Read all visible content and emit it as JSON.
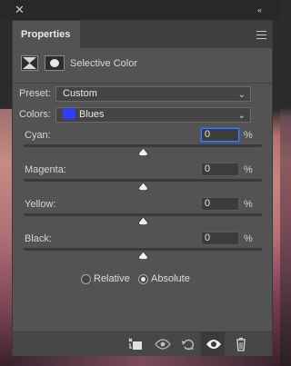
{
  "topbar": {
    "close_icon": "close-icon",
    "collapse_glyph": "‹‹"
  },
  "panel": {
    "tab_label": "Properties",
    "adjustment_title": "Selective Color",
    "preset": {
      "label": "Preset:",
      "value": "Custom"
    },
    "colors": {
      "label": "Colors:",
      "value": "Blues",
      "swatch_color": "#2f3dff"
    },
    "sliders": [
      {
        "label": "Cyan:",
        "value": "0",
        "unit": "%",
        "level": 0
      },
      {
        "label": "Magenta:",
        "value": "0",
        "unit": "%",
        "level": 0
      },
      {
        "label": "Yellow:",
        "value": "0",
        "unit": "%",
        "level": 0
      },
      {
        "label": "Black:",
        "value": "0",
        "unit": "%",
        "level": 0
      }
    ],
    "method": {
      "relative_label": "Relative",
      "absolute_label": "Absolute",
      "selected": "Absolute"
    },
    "bottom_icons": [
      "clip-to-layer-icon",
      "view-previous-state-icon",
      "reset-icon",
      "visibility-icon",
      "trash-icon"
    ],
    "accent_color": "#4d7be8"
  }
}
